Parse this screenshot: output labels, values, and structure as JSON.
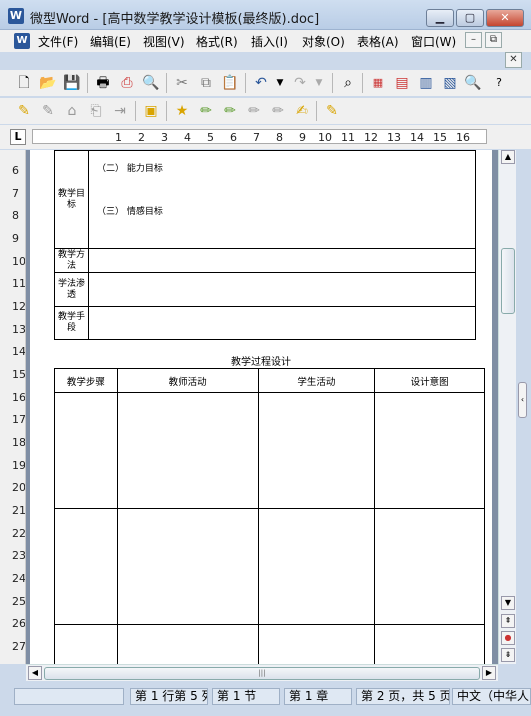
{
  "window": {
    "title": "微型Word - [高中数学教学设计模板(最终版).doc]"
  },
  "menubar": {
    "items": [
      "文件(F)",
      "编辑(E)",
      "视图(V)",
      "格式(R)",
      "插入(I)",
      "对象(O)",
      "表格(A)",
      "窗口(W)"
    ]
  },
  "ruler": {
    "numbers": [
      "1",
      "2",
      "3",
      "4",
      "5",
      "6",
      "7",
      "8",
      "9",
      "10",
      "11",
      "12",
      "13",
      "14",
      "15",
      "16"
    ]
  },
  "vruler": {
    "numbers": [
      "6",
      "7",
      "8",
      "9",
      "10",
      "11",
      "12",
      "13",
      "14",
      "15",
      "16",
      "17",
      "18",
      "19",
      "20",
      "21",
      "22",
      "23",
      "24",
      "25",
      "26",
      "27"
    ]
  },
  "document": {
    "table1": {
      "rows": [
        {
          "label": "教学目标",
          "lines": [
            "（二） 能力目标",
            "（三） 情感目标"
          ]
        },
        {
          "label": "教学方法"
        },
        {
          "label": "学法渗透"
        },
        {
          "label": "教学手段"
        }
      ]
    },
    "process_title": "教学过程设计",
    "table2": {
      "headers": [
        "教学步骤",
        "教师活动",
        "学生活动",
        "设计意图"
      ]
    }
  },
  "statusbar": {
    "row_col": "第 1 行第 5 列",
    "section": "第 1 节",
    "chapter": "第 1 章",
    "pages": "第 2 页，共 5 页",
    "language": "中文（中华人"
  }
}
